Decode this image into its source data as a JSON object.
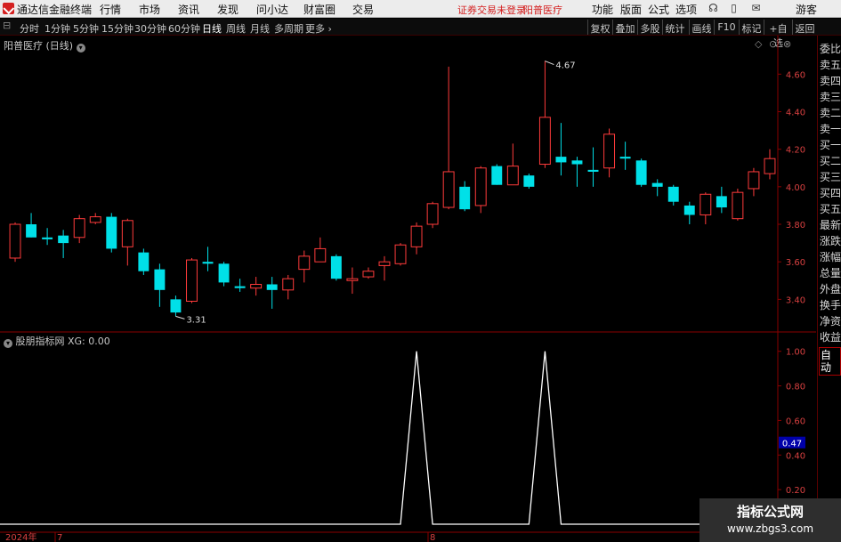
{
  "menubar": {
    "app_title": "通达信金融终端",
    "items": [
      "行情",
      "市场",
      "资讯",
      "发现",
      "问小达",
      "财富圈",
      "交易"
    ],
    "status_text": "证券交易未登录",
    "stock_name": "阳普医疗",
    "right_items": [
      "功能",
      "版面",
      "公式",
      "选项"
    ],
    "user": "游客"
  },
  "toolbar": {
    "periods": [
      "分时",
      "1分钟",
      "5分钟",
      "15分钟",
      "30分钟",
      "60分钟",
      "日线",
      "周线",
      "月线",
      "多周期",
      "更多"
    ],
    "active_period": "日线",
    "buttons": [
      "复权",
      "叠加",
      "多股",
      "统计",
      "画线",
      "F10",
      "标记",
      "+自选",
      "返回"
    ]
  },
  "chart": {
    "title": "阳普医疗 (日线)",
    "max_label": "4.67",
    "min_label": "3.31",
    "price_axis": [
      "4.60",
      "4.40",
      "4.20",
      "4.00",
      "3.80",
      "3.60",
      "3.40"
    ],
    "indicator_title": "股朋指标网 XG: 0.00",
    "indicator_axis": [
      "1.00",
      "0.80",
      "0.60",
      "0.40",
      "0.20"
    ],
    "indicator_cursor_value": "0.47",
    "date_year": "2024年",
    "date_month1": "7",
    "date_month2": "8"
  },
  "chart_data": {
    "type": "candlestick",
    "ylim": [
      3.25,
      4.72
    ],
    "colors": {
      "up": "#ff3b3b",
      "down": "#00e0e8",
      "flat": "#ffffff",
      "indicator": "#ffffff"
    },
    "candles": [
      {
        "o": 3.62,
        "c": 3.8,
        "h": 3.81,
        "l": 3.6
      },
      {
        "o": 3.8,
        "c": 3.73,
        "h": 3.86,
        "l": 3.73
      },
      {
        "o": 3.73,
        "c": 3.72,
        "h": 3.78,
        "l": 3.69
      },
      {
        "o": 3.74,
        "c": 3.7,
        "h": 3.77,
        "l": 3.62
      },
      {
        "o": 3.73,
        "c": 3.83,
        "h": 3.85,
        "l": 3.7
      },
      {
        "o": 3.81,
        "c": 3.84,
        "h": 3.86,
        "l": 3.8
      },
      {
        "o": 3.84,
        "c": 3.67,
        "h": 3.86,
        "l": 3.65
      },
      {
        "o": 3.68,
        "c": 3.82,
        "h": 3.83,
        "l": 3.58
      },
      {
        "o": 3.65,
        "c": 3.55,
        "h": 3.67,
        "l": 3.53
      },
      {
        "o": 3.56,
        "c": 3.45,
        "h": 3.59,
        "l": 3.36
      },
      {
        "o": 3.4,
        "c": 3.33,
        "h": 3.42,
        "l": 3.31
      },
      {
        "o": 3.39,
        "c": 3.61,
        "h": 3.62,
        "l": 3.38
      },
      {
        "o": 3.6,
        "c": 3.59,
        "h": 3.68,
        "l": 3.55
      },
      {
        "o": 3.59,
        "c": 3.49,
        "h": 3.6,
        "l": 3.47
      },
      {
        "o": 3.47,
        "c": 3.46,
        "h": 3.51,
        "l": 3.44
      },
      {
        "o": 3.46,
        "c": 3.48,
        "h": 3.52,
        "l": 3.42
      },
      {
        "o": 3.48,
        "c": 3.45,
        "h": 3.52,
        "l": 3.35
      },
      {
        "o": 3.45,
        "c": 3.51,
        "h": 3.53,
        "l": 3.4
      },
      {
        "o": 3.56,
        "c": 3.63,
        "h": 3.66,
        "l": 3.49
      },
      {
        "o": 3.6,
        "c": 3.67,
        "h": 3.73,
        "l": 3.6
      },
      {
        "o": 3.63,
        "c": 3.51,
        "h": 3.64,
        "l": 3.5
      },
      {
        "o": 3.5,
        "c": 3.51,
        "h": 3.57,
        "l": 3.43
      },
      {
        "o": 3.52,
        "c": 3.55,
        "h": 3.57,
        "l": 3.51
      },
      {
        "o": 3.58,
        "c": 3.6,
        "h": 3.63,
        "l": 3.5
      },
      {
        "o": 3.59,
        "c": 3.69,
        "h": 3.7,
        "l": 3.58
      },
      {
        "o": 3.68,
        "c": 3.79,
        "h": 3.81,
        "l": 3.64
      },
      {
        "o": 3.8,
        "c": 3.91,
        "h": 3.92,
        "l": 3.78
      },
      {
        "o": 3.89,
        "c": 4.08,
        "h": 4.64,
        "l": 3.88
      },
      {
        "o": 4.0,
        "c": 3.88,
        "h": 4.03,
        "l": 3.87
      },
      {
        "o": 3.9,
        "c": 4.1,
        "h": 4.11,
        "l": 3.86
      },
      {
        "o": 4.11,
        "c": 4.01,
        "h": 4.12,
        "l": 4.01
      },
      {
        "o": 4.01,
        "c": 4.11,
        "h": 4.23,
        "l": 4.01
      },
      {
        "o": 4.06,
        "c": 4.0,
        "h": 4.07,
        "l": 3.99
      },
      {
        "o": 4.12,
        "c": 4.37,
        "h": 4.67,
        "l": 4.1
      },
      {
        "o": 4.16,
        "c": 4.13,
        "h": 4.34,
        "l": 4.06
      },
      {
        "o": 4.14,
        "c": 4.12,
        "h": 4.16,
        "l": 4.0
      },
      {
        "o": 4.09,
        "c": 4.08,
        "h": 4.21,
        "l": 4.0
      },
      {
        "o": 4.1,
        "c": 4.28,
        "h": 4.31,
        "l": 4.05
      },
      {
        "o": 4.16,
        "c": 4.15,
        "h": 4.24,
        "l": 4.09
      },
      {
        "o": 4.14,
        "c": 4.01,
        "h": 4.15,
        "l": 4.0
      },
      {
        "o": 4.02,
        "c": 4.0,
        "h": 4.04,
        "l": 3.95
      },
      {
        "o": 4.0,
        "c": 3.92,
        "h": 4.01,
        "l": 3.9
      },
      {
        "o": 3.9,
        "c": 3.85,
        "h": 3.92,
        "l": 3.8
      },
      {
        "o": 3.85,
        "c": 3.96,
        "h": 3.97,
        "l": 3.8
      },
      {
        "o": 3.95,
        "c": 3.89,
        "h": 4.0,
        "l": 3.86
      },
      {
        "o": 3.83,
        "c": 3.97,
        "h": 3.99,
        "l": 3.82
      },
      {
        "o": 3.99,
        "c": 4.08,
        "h": 4.1,
        "l": 3.95
      },
      {
        "o": 4.07,
        "c": 4.15,
        "h": 4.2,
        "l": 4.04
      }
    ],
    "indicator_ylim": [
      0,
      1.05
    ],
    "indicator_values": [
      0,
      0,
      0,
      0,
      0,
      0,
      0,
      0,
      0,
      0,
      0,
      0,
      0,
      0,
      0,
      0,
      0,
      0,
      0,
      0,
      0,
      0,
      0,
      0,
      0,
      1,
      0,
      0,
      0,
      0,
      0,
      0,
      0,
      1,
      0,
      0,
      0,
      0,
      0,
      0,
      0,
      0,
      0,
      0,
      0,
      0,
      0,
      0
    ]
  },
  "side_panel": [
    "委比",
    "卖五",
    "卖四",
    "卖三",
    "卖二",
    "卖一",
    "买一",
    "买二",
    "买三",
    "买四",
    "买五",
    "最新",
    "涨跌",
    "涨幅",
    "总量",
    "外盘",
    "换手",
    "净资",
    "收益",
    "自动"
  ],
  "watermark": {
    "line1": "指标公式网",
    "line2": "www.zbgs3.com"
  }
}
